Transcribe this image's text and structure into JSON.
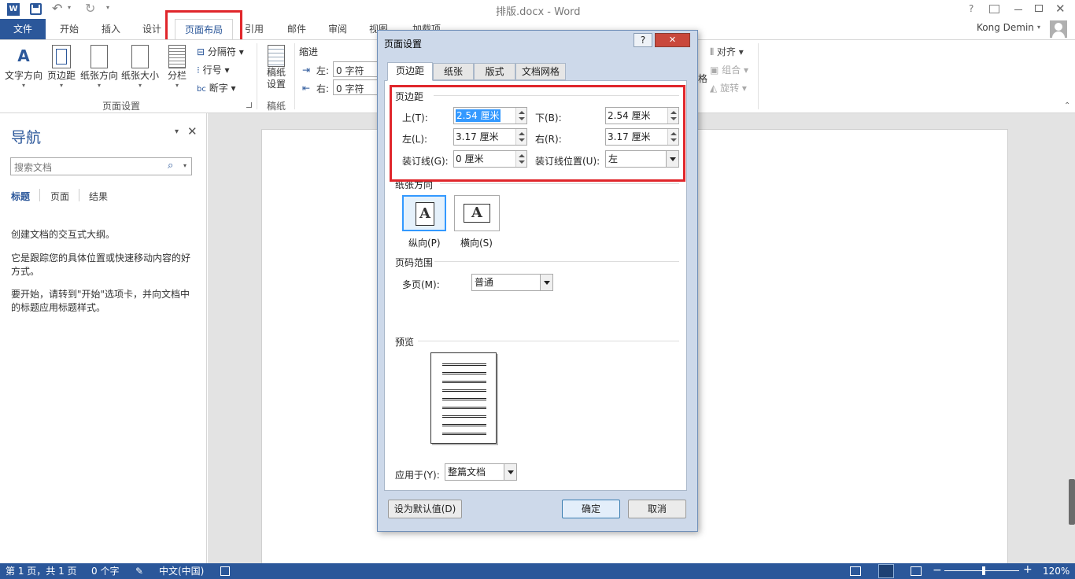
{
  "window": {
    "title": "排版.docx - Word",
    "help": "?",
    "user": "Kong Demin"
  },
  "tabs": {
    "file": "文件",
    "home": "开始",
    "insert": "插入",
    "design": "设计",
    "layout": "页面布局",
    "references": "引用",
    "mailings": "邮件",
    "review": "审阅",
    "view": "视图",
    "addins": "加载项"
  },
  "ribbon": {
    "text_direction": "文字方向",
    "margins": "页边距",
    "orientation": "纸张方向",
    "size": "纸张大小",
    "columns": "分栏",
    "breaks": "分隔符",
    "line_numbers": "行号",
    "hyphenation": "断字",
    "group_page_setup": "页面设置",
    "draft_paper": "稿纸设置",
    "group_draft": "稿纸",
    "indent_label": "缩进",
    "indent_left_label": "左:",
    "indent_left_value": "0 字符",
    "indent_right_label": "右:",
    "indent_right_value": "0 字符",
    "align": "对齐",
    "group": "组合",
    "rotate": "旋转",
    "arrange_partial": "格"
  },
  "nav": {
    "title": "导航",
    "search_placeholder": "搜索文档",
    "tab_headings": "标题",
    "tab_pages": "页面",
    "tab_results": "结果",
    "text1": "创建文档的交互式大纲。",
    "text2": "它是跟踪您的具体位置或快速移动内容的好方式。",
    "text3": "要开始，请转到\"开始\"选项卡，并向文档中的标题应用标题样式。"
  },
  "status": {
    "page": "第 1 页，共 1 页",
    "words": "0 个字",
    "lang": "中文(中国)",
    "zoom": "120%"
  },
  "dialog": {
    "title": "页面设置",
    "help": "?",
    "tabs": [
      "页边距",
      "纸张",
      "版式",
      "文档网格"
    ],
    "margins_section": "页边距",
    "top_label": "上(T):",
    "top_value": "2.54 厘米",
    "bottom_label": "下(B):",
    "bottom_value": "2.54 厘米",
    "left_label": "左(L):",
    "left_value": "3.17 厘米",
    "right_label": "右(R):",
    "right_value": "3.17 厘米",
    "gutter_label": "装订线(G):",
    "gutter_value": "0 厘米",
    "gutter_pos_label": "装订线位置(U):",
    "gutter_pos_value": "左",
    "orientation_section": "纸张方向",
    "portrait": "纵向(P)",
    "landscape": "横向(S)",
    "orientation_glyph": "A",
    "pages_section": "页码范围",
    "multiple_pages_label": "多页(M):",
    "multiple_pages_value": "普通",
    "preview_section": "预览",
    "apply_label": "应用于(Y):",
    "apply_value": "整篇文档",
    "default_button": "设为默认值(D)",
    "ok_button": "确定",
    "cancel_button": "取消"
  }
}
